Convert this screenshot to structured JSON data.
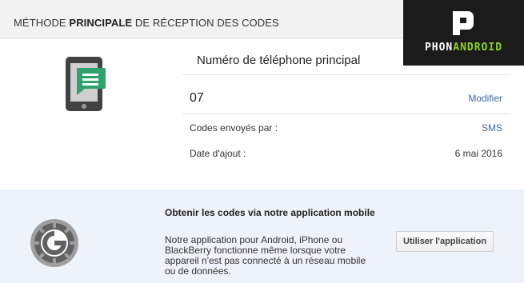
{
  "header": {
    "title_pre": "MÉTHODE ",
    "title_bold": "PRINCIPALE",
    "title_post": " DE RÉCEPTION DES CODES"
  },
  "logo": {
    "text_part1": "PHON",
    "text_part2": "ANDROID",
    "colors": {
      "background": "#1b1b1b",
      "accent": "#8ed11e"
    }
  },
  "phone_section": {
    "title": "Numéro de téléphone principal",
    "number": "07",
    "modify_label": "Modifier",
    "codes_label": "Codes envoyés par :",
    "codes_value": "SMS",
    "date_label": "Date d'ajout :",
    "date_value": "6 mai 2016",
    "icons": {
      "device": "phone-sms-icon"
    }
  },
  "app_section": {
    "title": "Obtenir les codes via notre application mobile",
    "description": "Notre application pour Android, iPhone ou BlackBerry fonctionne même lorsque votre appareil n'est pas connecté à un réseau mobile ou de données.",
    "button_label": "Utiliser l'application",
    "icon": "google-authenticator-icon"
  },
  "colors": {
    "link": "#3b6ba8",
    "sms_bubble": "#2ea36e",
    "panel_background": "#eef2fa"
  }
}
